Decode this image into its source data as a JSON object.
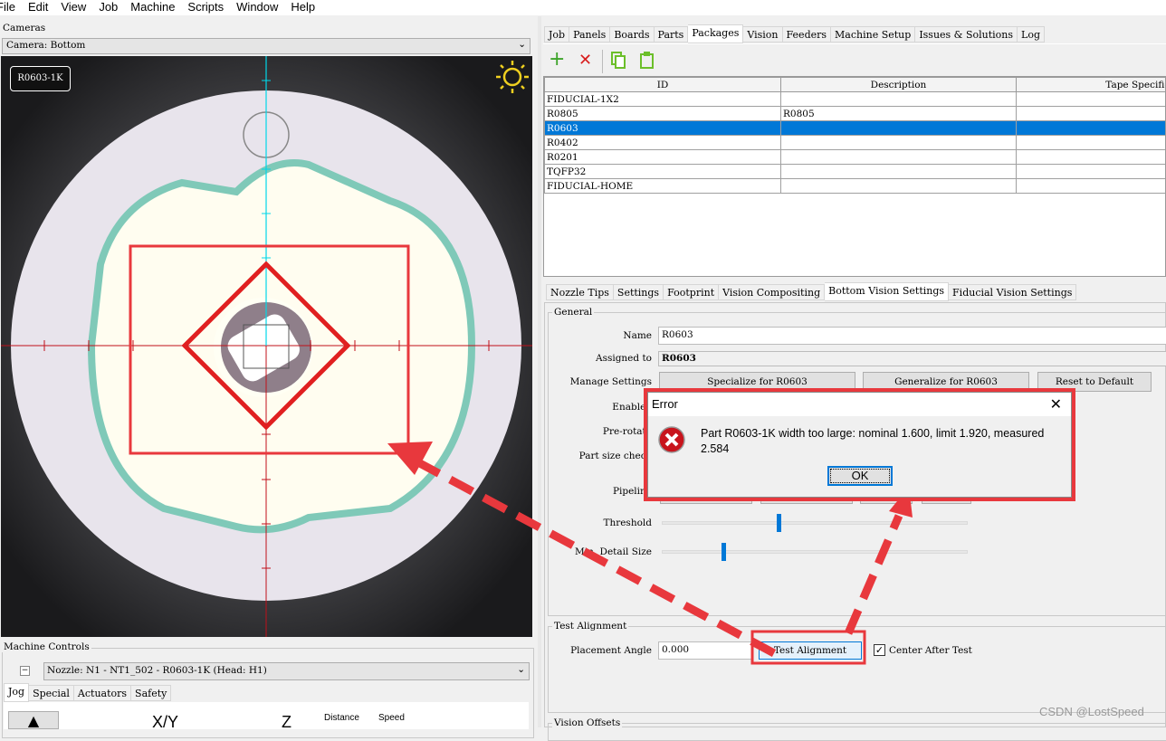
{
  "menu": [
    "File",
    "Edit",
    "View",
    "Job",
    "Machine",
    "Scripts",
    "Window",
    "Help"
  ],
  "cameras": {
    "title": "Cameras",
    "select_value": "Camera: Bottom",
    "part_label": "R0603-1K",
    "light_icon": "sun-icon"
  },
  "machine_controls": {
    "title": "Machine Controls",
    "nozzle_value": "Nozzle: N1 - NT1_502 - R0603-1K (Head: H1)",
    "tabs": [
      "Jog",
      "Special",
      "Actuators",
      "Safety"
    ],
    "xy_label": "X/Y",
    "z_label": "Z",
    "distance_label": "Distance",
    "speed_label": "Speed"
  },
  "main_tabs": [
    "Job",
    "Panels",
    "Boards",
    "Parts",
    "Packages",
    "Vision",
    "Feeders",
    "Machine Setup",
    "Issues & Solutions",
    "Log"
  ],
  "main_tab_selected": "Packages",
  "toolbar": {
    "add": "add-icon",
    "delete": "delete-icon",
    "copy": "copy-icon",
    "paste": "paste-icon"
  },
  "packages_table": {
    "columns": [
      "ID",
      "Description",
      "Tape Specificat"
    ],
    "rows": [
      [
        "FIDUCIAL-1X2",
        "",
        ""
      ],
      [
        "R0805",
        "R0805",
        ""
      ],
      [
        "R0603",
        "",
        ""
      ],
      [
        "R0402",
        "",
        ""
      ],
      [
        "R0201",
        "",
        ""
      ],
      [
        "TQFP32",
        "",
        ""
      ],
      [
        "FIDUCIAL-HOME",
        "",
        ""
      ]
    ],
    "selected_row": "R0603"
  },
  "detail_tabs": [
    "Nozzle Tips",
    "Settings",
    "Footprint",
    "Vision Compositing",
    "Bottom Vision Settings",
    "Fiducial Vision Settings"
  ],
  "detail_tab_selected": "Bottom Vision Settings",
  "general": {
    "title": "General",
    "name_label": "Name",
    "name_value": "R0603",
    "assigned_label": "Assigned to",
    "assigned_value": "R0603",
    "manage_label": "Manage Settings",
    "specialize": "Specialize for  R0603",
    "generalize": "Generalize for R0603",
    "reset": "Reset to Default",
    "enabled_label": "Enabled",
    "prerotate_label": "Pre-rotate",
    "partsize_label": "Part size check",
    "pipeline_label": "Pipeline",
    "threshold_label": "Threshold",
    "threshold_value": 0.38,
    "mindetail_label": "Min. Detail Size",
    "mindetail_value": 0.2
  },
  "test_alignment": {
    "title": "Test Alignment",
    "angle_label": "Placement Angle",
    "angle_value": "0.000",
    "button": "Test Alignment",
    "center_label": "Center After Test",
    "center_checked": true
  },
  "vision_offsets": {
    "title": "Vision Offsets"
  },
  "error_dialog": {
    "title": "Error",
    "message": "Part R0603-1K width too large: nominal 1.600, limit 1.920, measured 2.584",
    "ok": "OK",
    "icon": "error-icon"
  },
  "watermark": "CSDN @LostSpeed",
  "colors": {
    "selection": "#0078d7",
    "annotation": "#e8383d",
    "crosshair_red": "#c0101a",
    "crosshair_cyan": "#00d8e8"
  }
}
